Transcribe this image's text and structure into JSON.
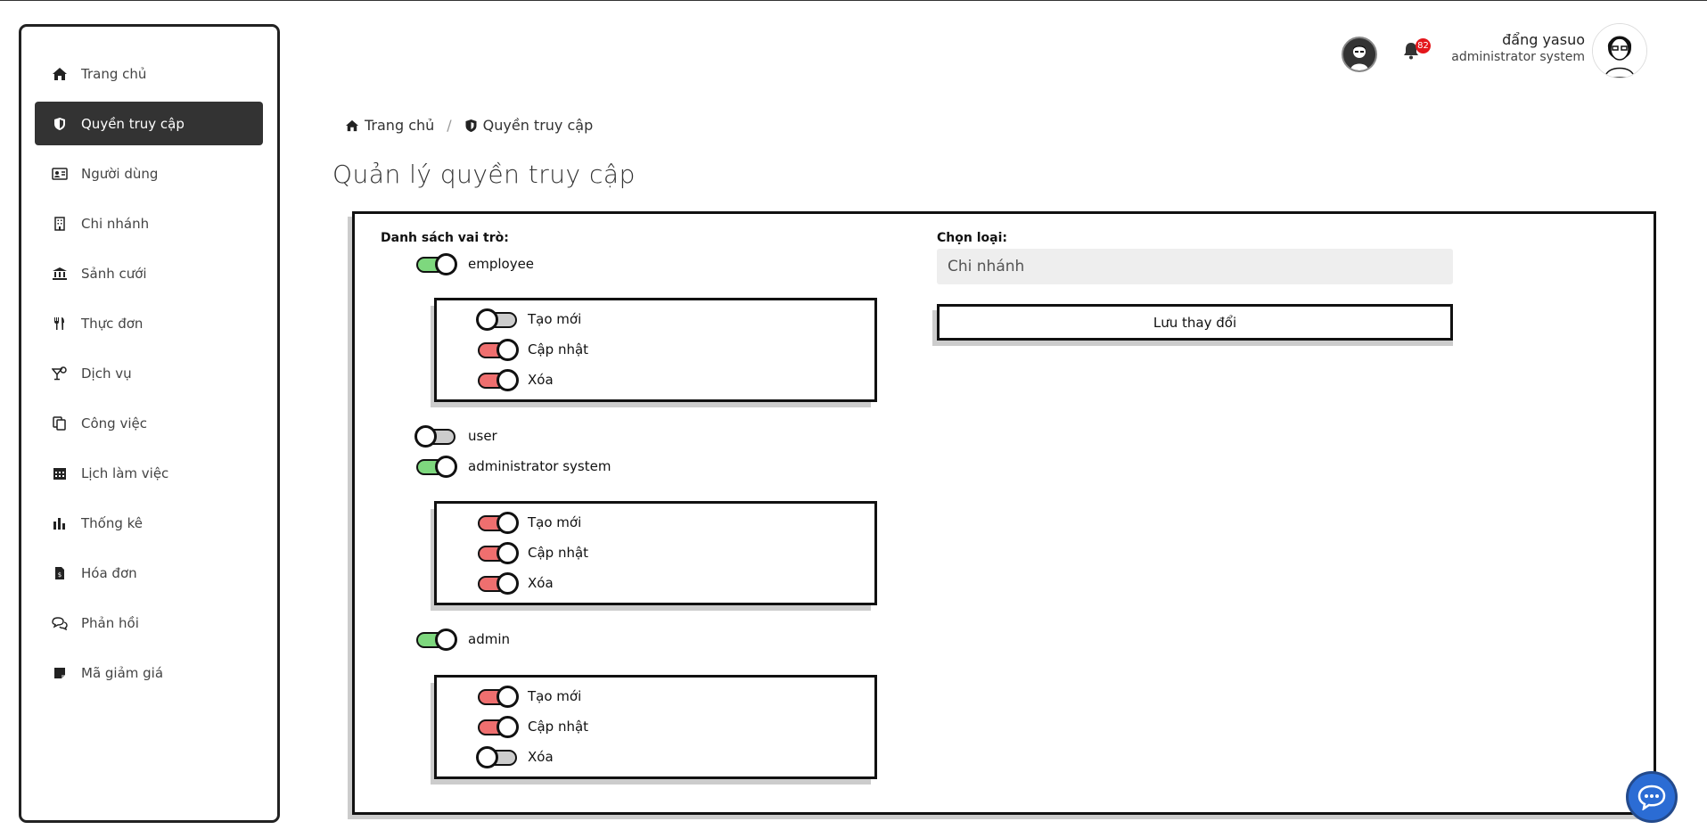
{
  "sidebar": {
    "items": [
      {
        "label": "Trang chủ",
        "icon": "home-icon"
      },
      {
        "label": "Quyền truy cập",
        "icon": "shield-icon",
        "active": true
      },
      {
        "label": "Người dùng",
        "icon": "id-card-icon"
      },
      {
        "label": "Chi nhánh",
        "icon": "building-icon"
      },
      {
        "label": "Sảnh cưới",
        "icon": "bank-icon"
      },
      {
        "label": "Thực đơn",
        "icon": "utensils-icon"
      },
      {
        "label": "Dịch vụ",
        "icon": "cocktail-icon"
      },
      {
        "label": "Công việc",
        "icon": "copy-icon"
      },
      {
        "label": "Lịch làm việc",
        "icon": "calendar-icon"
      },
      {
        "label": "Thống kê",
        "icon": "bar-chart-icon"
      },
      {
        "label": "Hóa đơn",
        "icon": "invoice-icon"
      },
      {
        "label": "Phản hồi",
        "icon": "chat-bubbles-icon"
      },
      {
        "label": "Mã giảm giá",
        "icon": "note-icon"
      }
    ]
  },
  "header": {
    "notification_count": "82",
    "user_name": "đẩng yasuo",
    "user_role": "administrator system"
  },
  "breadcrumb": {
    "home": "Trang chủ",
    "separator": "/",
    "current": "Quyền truy cập"
  },
  "page_title": "Quản lý quyền truy cập",
  "roles": {
    "label": "Danh sách vai trò:",
    "items": [
      {
        "name": "employee",
        "enabled": true,
        "permissions": [
          {
            "label": "Tạo mới",
            "state": "off"
          },
          {
            "label": "Cập nhật",
            "state": "red"
          },
          {
            "label": "Xóa",
            "state": "red"
          }
        ]
      },
      {
        "name": "user",
        "enabled": false,
        "permissions": []
      },
      {
        "name": "administrator system",
        "enabled": true,
        "permissions": [
          {
            "label": "Tạo mới",
            "state": "red"
          },
          {
            "label": "Cập nhật",
            "state": "red"
          },
          {
            "label": "Xóa",
            "state": "red"
          }
        ]
      },
      {
        "name": "admin",
        "enabled": true,
        "permissions": [
          {
            "label": "Tạo mới",
            "state": "red"
          },
          {
            "label": "Cập nhật",
            "state": "red"
          },
          {
            "label": "Xóa",
            "state": "off"
          }
        ]
      }
    ]
  },
  "type_select": {
    "label": "Chọn loại:",
    "value": "Chi nhánh"
  },
  "save_button": "Lưu thay đổi",
  "colors": {
    "toggle_on": "#7ed87e",
    "toggle_red": "#ef6f6f",
    "toggle_off": "#cccccc",
    "sidebar_active": "#333333",
    "badge": "#e4161b",
    "chat_button": "#2b6cd4"
  }
}
